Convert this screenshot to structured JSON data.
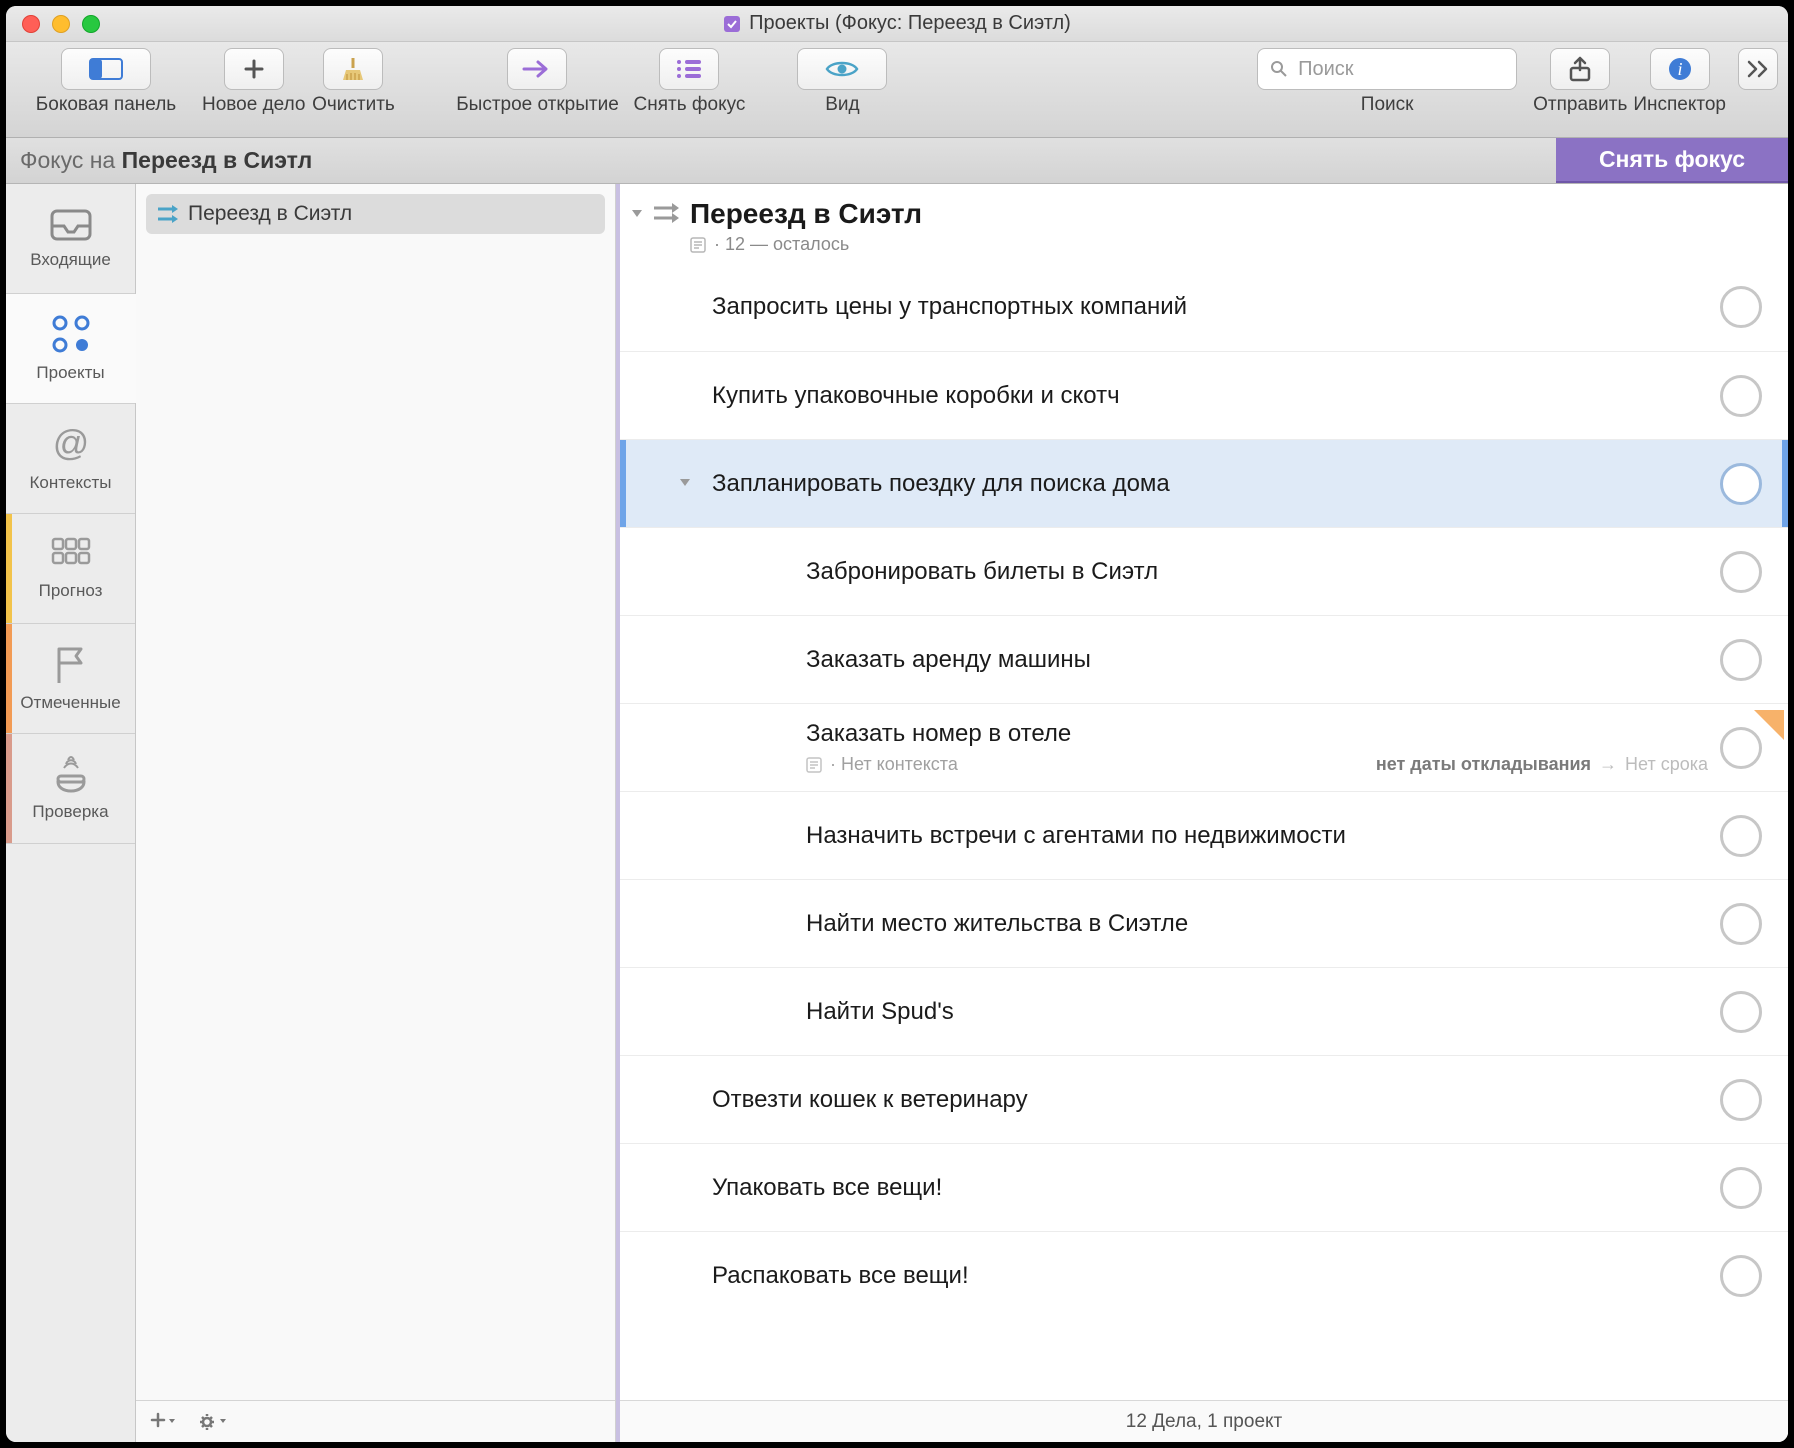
{
  "window": {
    "title": "Проекты (Фокус: Переезд в Сиэтл)"
  },
  "toolbar": {
    "sidebar": "Боковая панель",
    "new_action": "Новое дело",
    "cleanup": "Очистить",
    "quick_open": "Быстрое открытие",
    "unfocus": "Снять фокус",
    "view": "Вид",
    "search_label": "Поиск",
    "search_placeholder": "Поиск",
    "share": "Отправить",
    "inspector": "Инспектор"
  },
  "focusbar": {
    "prefix": "Фокус на ",
    "target": "Переезд в Сиэтл",
    "unfocus": "Снять фокус"
  },
  "tabs": {
    "inbox": "Входящие",
    "projects": "Проекты",
    "contexts": "Контексты",
    "forecast": "Прогноз",
    "flagged": "Отмеченные",
    "review": "Проверка"
  },
  "sidebar": {
    "project": "Переезд в Сиэтл"
  },
  "project": {
    "title": "Переезд в Сиэтл",
    "remaining_count": "12",
    "remaining_label": "осталось"
  },
  "tasks": [
    {
      "title": "Запросить цены у транспортных компаний",
      "indent": 0
    },
    {
      "title": "Купить упаковочные коробки и скотч",
      "indent": 0
    },
    {
      "title": "Запланировать поездку для поиска дома",
      "indent": 0,
      "selected": true,
      "group": true
    },
    {
      "title": "Забронировать билеты в Сиэтл",
      "indent": 1
    },
    {
      "title": "Заказать аренду машины",
      "indent": 1
    },
    {
      "title": "Заказать номер в отеле",
      "indent": 1,
      "no_context": "Нет контекста",
      "defer": "нет даты откладывания",
      "due": "Нет срока",
      "flag": true
    },
    {
      "title": "Назначить встречи с агентами по недвижимости",
      "indent": 1
    },
    {
      "title": "Найти место жительства в Сиэтле",
      "indent": 1
    },
    {
      "title": "Найти Spud's",
      "indent": 1
    },
    {
      "title": "Отвезти кошек к ветеринару",
      "indent": 0
    },
    {
      "title": "Упаковать все вещи!",
      "indent": 0
    },
    {
      "title": "Распаковать все вещи!",
      "indent": 0
    }
  ],
  "statusbar": "12 Дела, 1 проект"
}
